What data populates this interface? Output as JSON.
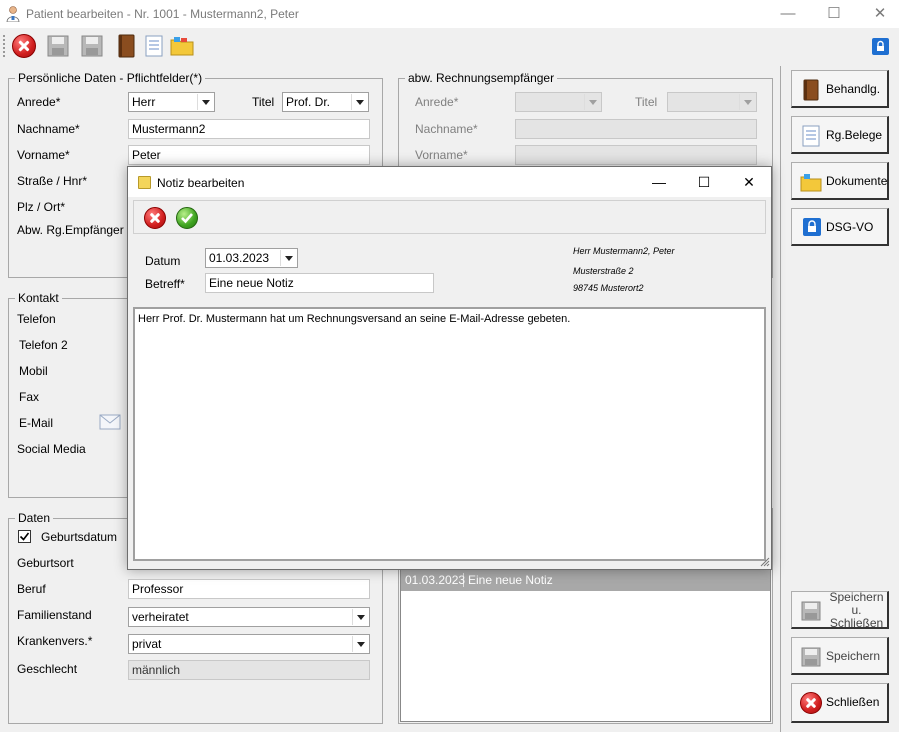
{
  "window": {
    "title": "Patient bearbeiten - Nr. 1001 - Mustermann2, Peter",
    "minimize": "—",
    "maximize": "☐",
    "close": "✕"
  },
  "toolbar": {
    "icons": [
      "close-icon",
      "save-icon",
      "save-close-icon",
      "book-icon",
      "receipt-icon",
      "folder-icon",
      "lock-icon"
    ]
  },
  "personal": {
    "group_title": "Persönliche Daten - Pflichtfelder(*)",
    "anrede_label": "Anrede*",
    "anrede_value": "Herr",
    "titel_label": "Titel",
    "titel_value": "Prof. Dr.",
    "nachname_label": "Nachname*",
    "nachname_value": "Mustermann2",
    "vorname_label": "Vorname*",
    "vorname_value": "Peter",
    "strasse_label": "Straße / Hnr*",
    "plz_label": "Plz / Ort*",
    "abw_label": "Abw. Rg.Empfänger"
  },
  "billing": {
    "group_title": "abw. Rechnungsempfänger",
    "anrede_label": "Anrede*",
    "titel_label": "Titel",
    "nachname_label": "Nachname*",
    "vorname_label": "Vorname*"
  },
  "contact": {
    "group_title": "Kontakt",
    "telefon": "Telefon",
    "telefon2": "Telefon 2",
    "mobil": "Mobil",
    "fax": "Fax",
    "email": "E-Mail",
    "social": "Social Media"
  },
  "daten": {
    "group_title": "Daten",
    "geburtsdatum_label": "Geburtsdatum",
    "geburtsort_label": "Geburtsort",
    "beruf_label": "Beruf",
    "beruf_value": "Professor",
    "familienstand_label": "Familienstand",
    "familienstand_value": "verheiratet",
    "krankenvers_label": "Krankenvers.*",
    "krankenvers_value": "privat",
    "geschlecht_label": "Geschlecht",
    "geschlecht_value": "männlich"
  },
  "notes_list": {
    "rows": [
      {
        "datum": "01.03.2023",
        "betreff": "Eine neue Notiz"
      }
    ]
  },
  "sidebar": {
    "behandlg": "Behandlg.",
    "rgbelege": "Rg.Belege",
    "dokumente": "Dokumente",
    "dsgvo": "DSG-VO",
    "speichern_schliessen_1": "Speichern u.",
    "speichern_schliessen_2": "Schließen",
    "speichern": "Speichern",
    "schliessen": "Schließen"
  },
  "dialog": {
    "title": "Notiz bearbeiten",
    "minimize": "—",
    "maximize": "☐",
    "close": "✕",
    "datum_label": "Datum",
    "datum_value": "01.03.2023",
    "betreff_label": "Betreff*",
    "betreff_value": "Eine neue Notiz",
    "address_line1": "Herr Mustermann2, Peter",
    "address_line2": "Musterstraße 2",
    "address_line3": "98745 Musterort2",
    "note_text": "Herr Prof. Dr. Mustermann hat um Rechnungsversand an seine E-Mail-Adresse gebeten."
  }
}
